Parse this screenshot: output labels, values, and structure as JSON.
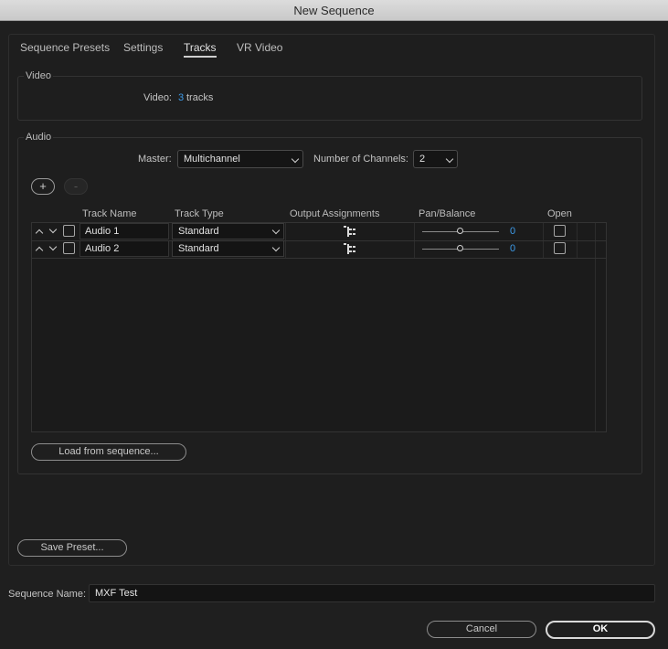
{
  "window": {
    "title": "New Sequence"
  },
  "tabs": [
    {
      "label": "Sequence Presets"
    },
    {
      "label": "Settings"
    },
    {
      "label": "Tracks"
    },
    {
      "label": "VR Video"
    }
  ],
  "video": {
    "group_label": "Video",
    "label": "Video:",
    "count": "3",
    "unit": "tracks"
  },
  "audio": {
    "group_label": "Audio",
    "master_label": "Master:",
    "master_value": "Multichannel",
    "channels_label": "Number of Channels:",
    "channels_value": "2",
    "add_label": "+",
    "remove_label": "-",
    "columns": [
      "Track Name",
      "Track Type",
      "Output Assignments",
      "Pan/Balance",
      "Open"
    ],
    "tracks": [
      {
        "name": "Audio 1",
        "type": "Standard",
        "pan": "0"
      },
      {
        "name": "Audio 2",
        "type": "Standard",
        "pan": "0"
      }
    ],
    "load_button": "Load from sequence..."
  },
  "save_preset_button": "Save Preset...",
  "sequence_name": {
    "label": "Sequence Name:",
    "value": "MXF Test"
  },
  "buttons": {
    "cancel": "Cancel",
    "ok": "OK"
  },
  "colors": {
    "accent": "#3d9be9",
    "background": "#1f1f1f"
  }
}
